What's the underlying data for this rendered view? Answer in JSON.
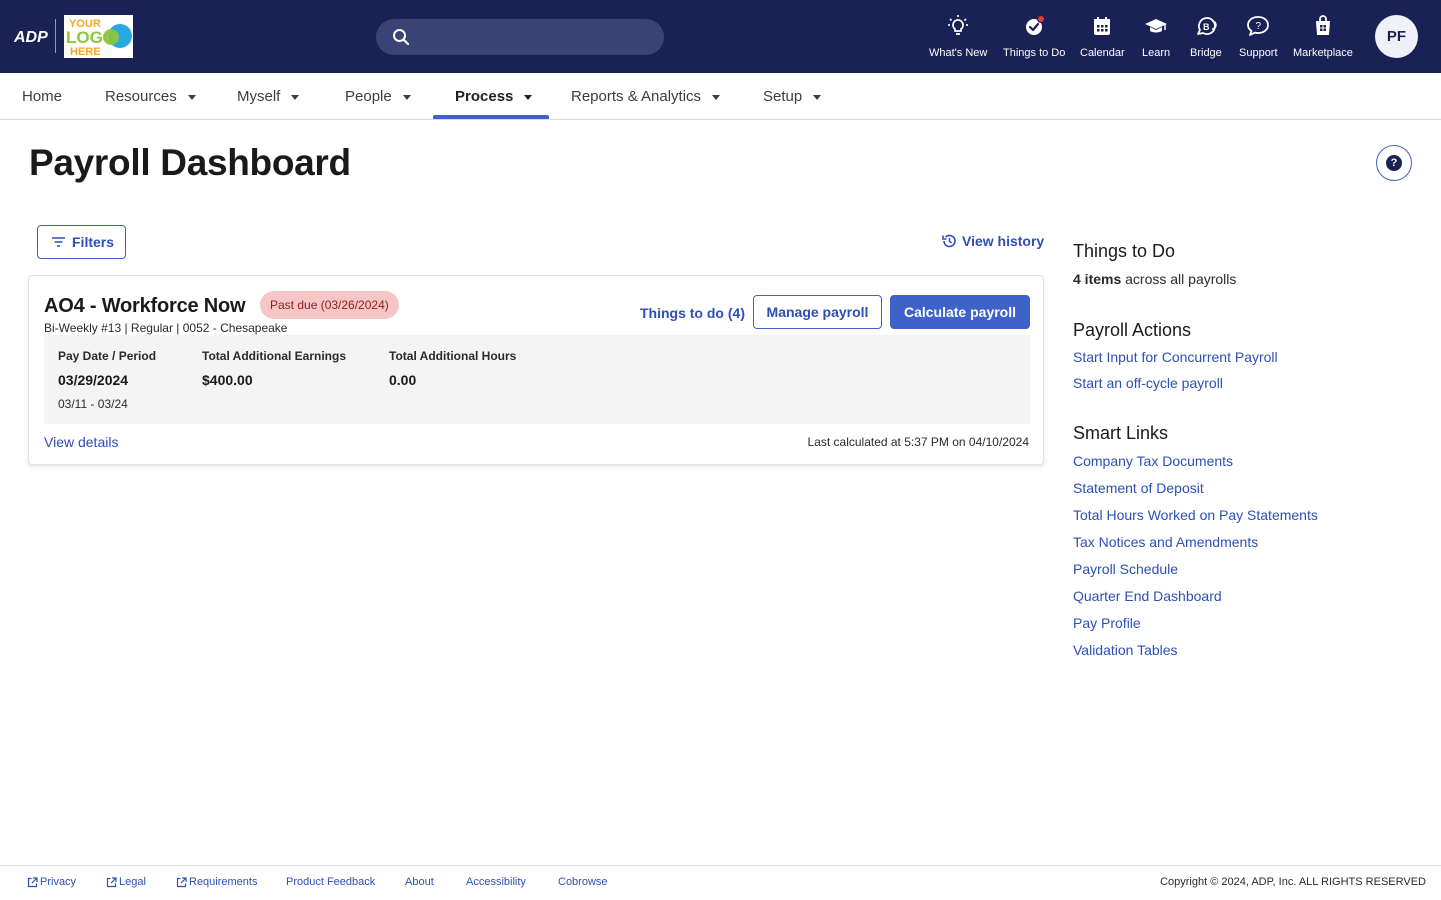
{
  "header": {
    "brand": "ADP",
    "logo_text": [
      "YOUR",
      "LOGO",
      "HERE"
    ],
    "search": {
      "placeholder": ""
    },
    "nav": [
      {
        "label": "What's New",
        "icon": "lightbulb-icon"
      },
      {
        "label": "Things to Do",
        "icon": "check-circle-icon",
        "has_notification": true
      },
      {
        "label": "Calendar",
        "icon": "calendar-icon"
      },
      {
        "label": "Learn",
        "icon": "graduation-cap-icon"
      },
      {
        "label": "Bridge",
        "icon": "bridge-icon"
      },
      {
        "label": "Support",
        "icon": "chat-bubble-icon"
      },
      {
        "label": "Marketplace",
        "icon": "marketplace-icon"
      }
    ],
    "avatar_initials": "PF"
  },
  "menu": {
    "items": [
      {
        "label": "Home",
        "has_dropdown": false
      },
      {
        "label": "Resources",
        "has_dropdown": true
      },
      {
        "label": "Myself",
        "has_dropdown": true
      },
      {
        "label": "People",
        "has_dropdown": true
      },
      {
        "label": "Process",
        "has_dropdown": true,
        "active": true
      },
      {
        "label": "Reports & Analytics",
        "has_dropdown": true
      },
      {
        "label": "Setup",
        "has_dropdown": true
      }
    ]
  },
  "page": {
    "title": "Payroll Dashboard",
    "help_label": "?",
    "filters_label": "Filters",
    "view_history_label": "View history"
  },
  "payroll_card": {
    "title": "AO4 - Workforce Now",
    "badge": "Past due (03/26/2024)",
    "subtitle": "Bi-Weekly #13 | Regular | 0052 - Chesapeake",
    "things_to_do_label": "Things to do (4)",
    "manage_label": "Manage payroll",
    "calculate_label": "Calculate payroll",
    "stats": [
      {
        "label": "Pay Date / Period",
        "value": "03/29/2024",
        "sub": "03/11 - 03/24"
      },
      {
        "label": "Total Additional Earnings",
        "value": "$400.00"
      },
      {
        "label": "Total Additional Hours",
        "value": "0.00"
      }
    ],
    "view_details_label": "View details",
    "last_calculated": "Last calculated at 5:37 PM on 04/10/2024"
  },
  "sidebar": {
    "things_to_do": {
      "heading": "Things to Do",
      "count_bold": "4 items",
      "count_rest": " across all payrolls"
    },
    "payroll_actions": {
      "heading": "Payroll Actions",
      "links": [
        "Start Input for Concurrent Payroll",
        "Start an off-cycle payroll"
      ]
    },
    "smart_links": {
      "heading": "Smart Links",
      "links": [
        "Company Tax Documents",
        "Statement of Deposit",
        "Total Hours Worked on Pay Statements",
        "Tax Notices and Amendments",
        "Payroll Schedule",
        "Quarter End Dashboard",
        "Pay Profile",
        "Validation Tables"
      ]
    }
  },
  "footer": {
    "links": [
      {
        "label": "Privacy",
        "external": true
      },
      {
        "label": "Legal",
        "external": true
      },
      {
        "label": "Requirements",
        "external": true
      },
      {
        "label": "Product Feedback",
        "external": false
      },
      {
        "label": "About",
        "external": false
      },
      {
        "label": "Accessibility",
        "external": false
      },
      {
        "label": "Cobrowse",
        "external": false
      }
    ],
    "copyright": "Copyright © 2024, ADP, Inc. ALL RIGHTS RESERVED"
  },
  "colors": {
    "header_bg": "#1a2155",
    "accent": "#3f62c8",
    "link": "#2e4fb5",
    "past_due_bg": "#f6c6c6",
    "past_due_text": "#8a1f1f",
    "notification_dot": "#e53935"
  }
}
